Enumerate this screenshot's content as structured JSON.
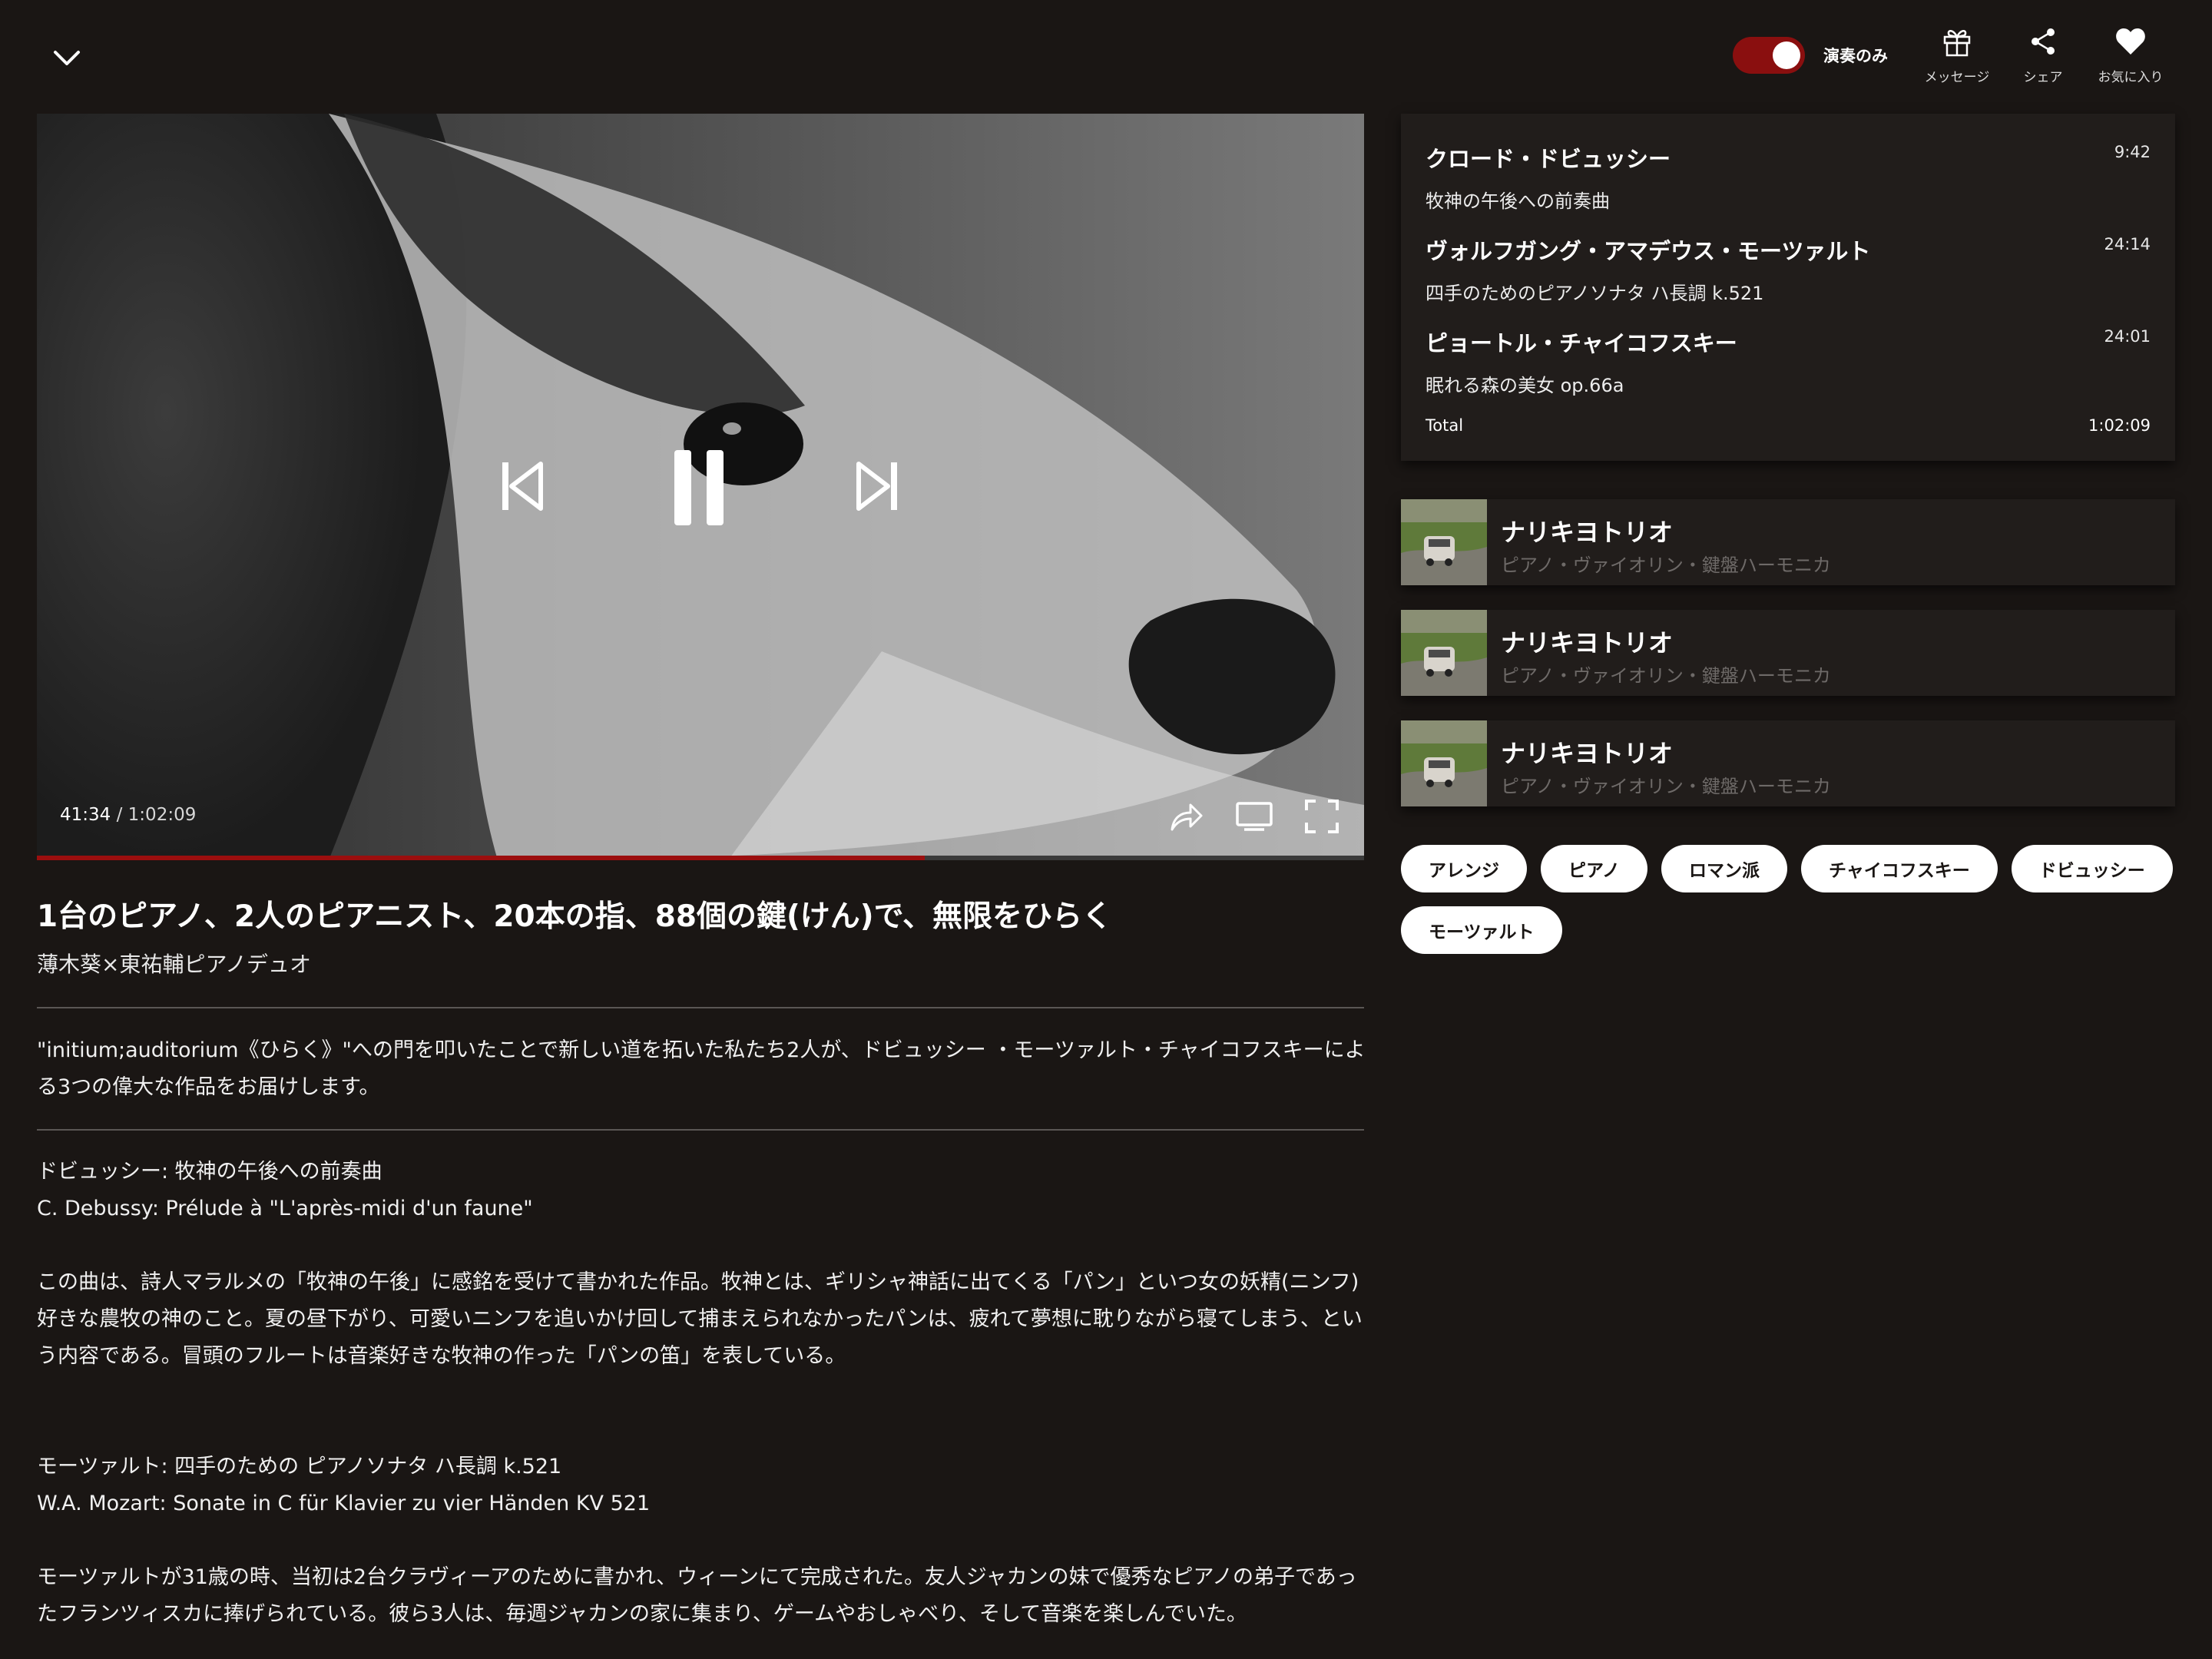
{
  "header": {
    "toggle_label": "演奏のみ",
    "toggle_on": true,
    "actions": [
      {
        "icon": "gift-icon",
        "label": "メッセージ"
      },
      {
        "icon": "share-icon",
        "label": "シェア"
      },
      {
        "icon": "heart-icon",
        "label": "お気に入り"
      }
    ]
  },
  "player": {
    "current_time": "41:34",
    "separator": " / ",
    "duration": "1:02:09",
    "progress": 0.6687,
    "accent_color": "#9b0e0e"
  },
  "video": {
    "title": "1台のピアノ、2人のピアニスト、20本の指、88個の鍵(けん)で、無限をひらく",
    "artist": "薄木葵×東祐輔ピアノデュオ"
  },
  "description": "\"initium;auditorium《ひらく》\"への門を叩いたことで新しい道を拓いた私たち2人が、ドビュッシー ・モーツァルト・チャイコフスキーによる3つの偉大な作品をお届けします。",
  "notes": {
    "debussy_jp": "ドビュッシー: 牧神の午後への前奏曲",
    "debussy_en": "C. Debussy: Prélude à \"L'après-midi d'un faune\"",
    "debussy_text": "この曲は、詩人マラルメの「牧神の午後」に感銘を受けて書かれた作品。牧神とは、ギリシャ神話に出てくる「パン」といつ女の妖精(ニンフ)好きな農牧の神のこと。夏の昼下がり、可愛いニンフを追いかけ回して捕まえられなかったパンは、疲れて夢想に耽りながら寝てしまう、という内容である。冒頭のフルートは音楽好きな牧神の作った「パンの笛」を表している。",
    "mozart_jp": "モーツァルト: 四手のための ピアノソナタ ハ長調 k.521",
    "mozart_en": "W.A. Mozart: Sonate in C für Klavier zu vier Händen KV 521",
    "mozart_text": "モーツァルトが31歳の時、当初は2台クラヴィーアのために書かれ、ウィーンにて完成された。友人ジャカンの妹で優秀なピアノの弟子であったフランツィスカに捧げられている。彼ら3人は、毎週ジャカンの家に集まり、ゲームやおしゃべり、そして音楽を楽しんでいた。"
  },
  "tracklist": {
    "tracks": [
      {
        "composer": "クロード・ドビュッシー",
        "work": "牧神の午後への前奏曲",
        "duration": "9:42"
      },
      {
        "composer": "ヴォルフガング・アマデウス・モーツァルト",
        "work": "四手のためのピアノソナタ ハ長調 k.521",
        "duration": "24:14"
      },
      {
        "composer": "ピョートル・チャイコフスキー",
        "work": "眠れる森の美女 op.66a",
        "duration": "24:01"
      }
    ],
    "total_label": "Total",
    "total": "1:02:09"
  },
  "recommendations": [
    {
      "title": "ナリキヨトリオ",
      "subtitle": "ピアノ・ヴァイオリン・鍵盤ハーモニカ"
    },
    {
      "title": "ナリキヨトリオ",
      "subtitle": "ピアノ・ヴァイオリン・鍵盤ハーモニカ"
    },
    {
      "title": "ナリキヨトリオ",
      "subtitle": "ピアノ・ヴァイオリン・鍵盤ハーモニカ"
    }
  ],
  "tags": [
    "アレンジ",
    "ピアノ",
    "ロマン派",
    "チャイコフスキー",
    "ドビュッシー",
    "モーツァルト"
  ]
}
